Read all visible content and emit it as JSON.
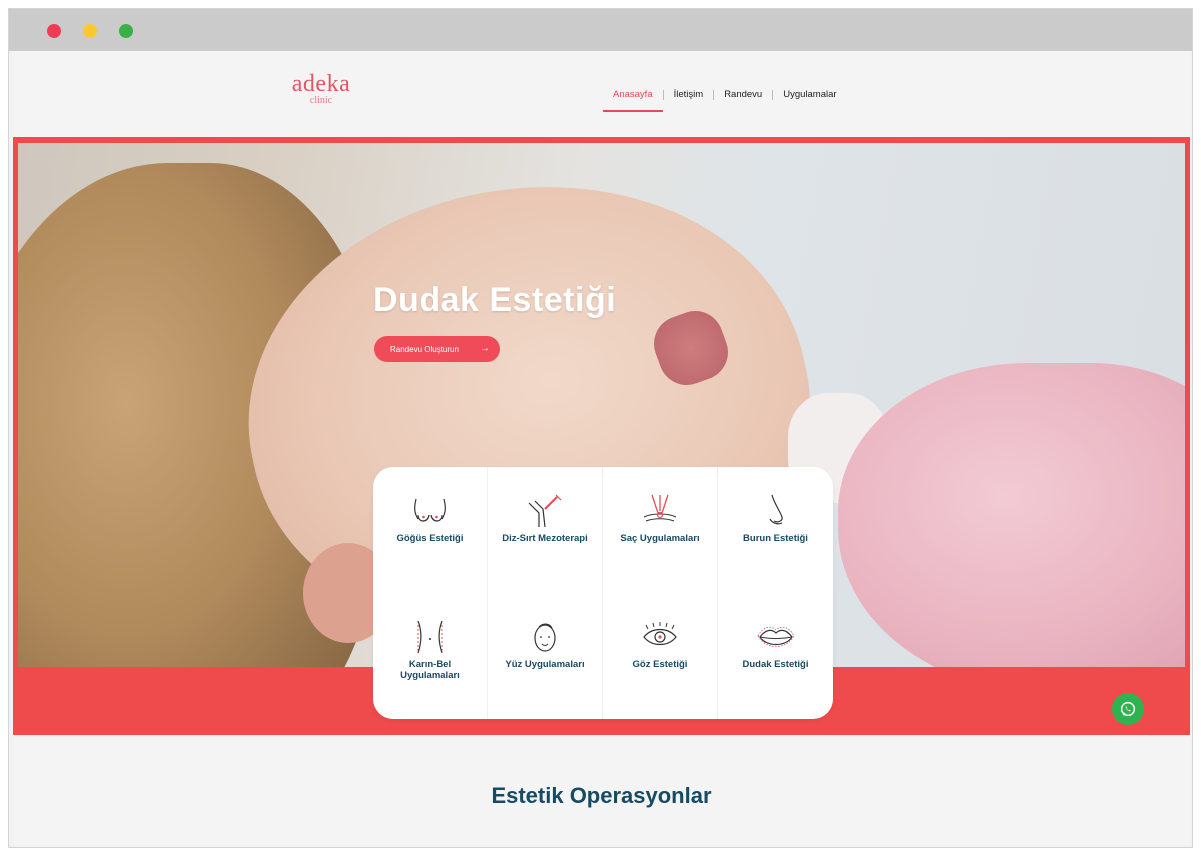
{
  "window": {
    "controls": [
      "close",
      "minimize",
      "maximize"
    ]
  },
  "brand": {
    "name": "adeka",
    "sub": "clinic",
    "color": "#e55563"
  },
  "nav": {
    "items": [
      {
        "label": "Anasayfa",
        "active": true
      },
      {
        "label": "İletişim",
        "active": false
      },
      {
        "label": "Randevu",
        "active": false
      },
      {
        "label": "Uygulamalar",
        "active": false
      }
    ]
  },
  "hero": {
    "title": "Dudak Estetiği",
    "cta_label": "Randevu Oluşturun",
    "accent": "#ef4b4c"
  },
  "services": [
    {
      "label": "Göğüs Estetiği",
      "icon": "chest-icon"
    },
    {
      "label": "Diz-Sırt Mezoterapi",
      "icon": "knee-injection-icon"
    },
    {
      "label": "Saç Uygulamaları",
      "icon": "hair-treatment-icon"
    },
    {
      "label": "Burun Estetiği",
      "icon": "nose-icon"
    },
    {
      "label": "Karın-Bel Uygulamaları",
      "icon": "waist-icon"
    },
    {
      "label": "Yüz Uygulamaları",
      "icon": "face-icon"
    },
    {
      "label": "Göz Estetiği",
      "icon": "eye-icon"
    },
    {
      "label": "Dudak Estetiği",
      "icon": "lips-icon"
    }
  ],
  "section": {
    "title": "Estetik Operasyonlar"
  },
  "colors": {
    "primary": "#ef4b4c",
    "navy": "#174a63",
    "whatsapp": "#2fb350"
  }
}
